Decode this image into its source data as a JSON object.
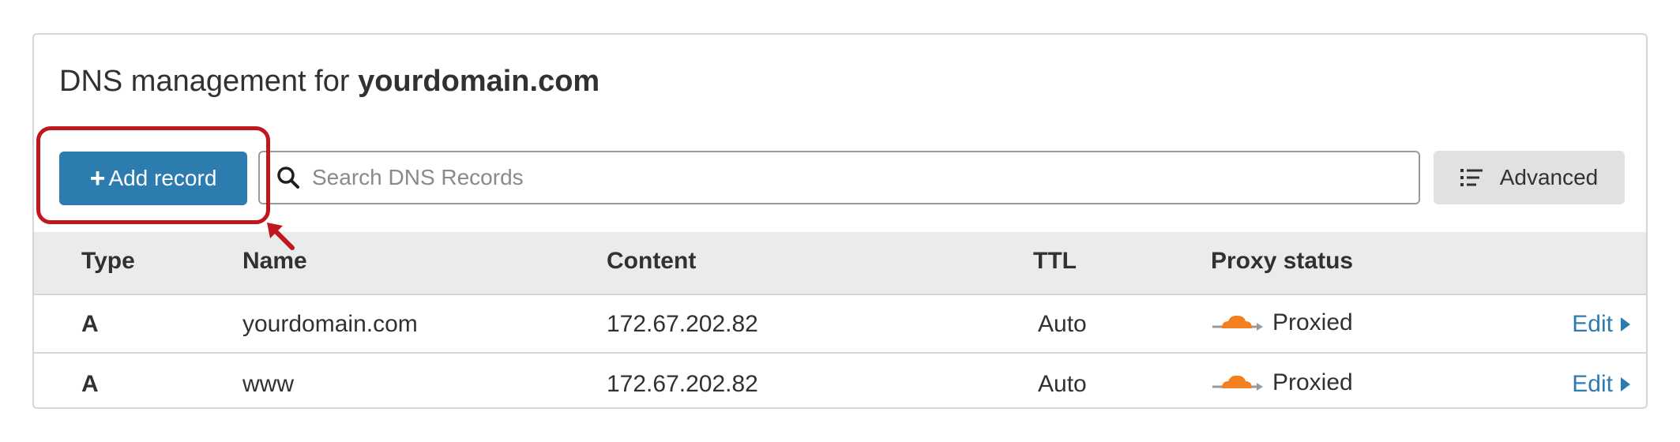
{
  "page": {
    "title_prefix": "DNS management for",
    "domain": "yourdomain.com"
  },
  "toolbar": {
    "add_record_label": "Add record",
    "add_record_plus": "+",
    "search_placeholder": "Search DNS Records",
    "search_value": "",
    "advanced_label": "Advanced"
  },
  "table": {
    "headers": {
      "type": "Type",
      "name": "Name",
      "content": "Content",
      "ttl": "TTL",
      "proxy_status": "Proxy status"
    },
    "rows": [
      {
        "type": "A",
        "name": "yourdomain.com",
        "content": "172.67.202.82",
        "ttl": "Auto",
        "proxy": "Proxied",
        "action": "Edit"
      },
      {
        "type": "A",
        "name": "www",
        "content": "172.67.202.82",
        "ttl": "Auto",
        "proxy": "Proxied",
        "action": "Edit"
      }
    ]
  },
  "colors": {
    "primary": "#2c7cb0",
    "cloud_orange": "#f38020",
    "highlight_red": "#c0161d",
    "header_bg": "#eaebeb",
    "advanced_bg": "#e1e1e1"
  },
  "icons": {
    "search": "search-icon",
    "advanced": "list-icon",
    "proxy": "cloud-icon",
    "edit": "caret-right-icon",
    "annotation": "arrow-icon"
  }
}
